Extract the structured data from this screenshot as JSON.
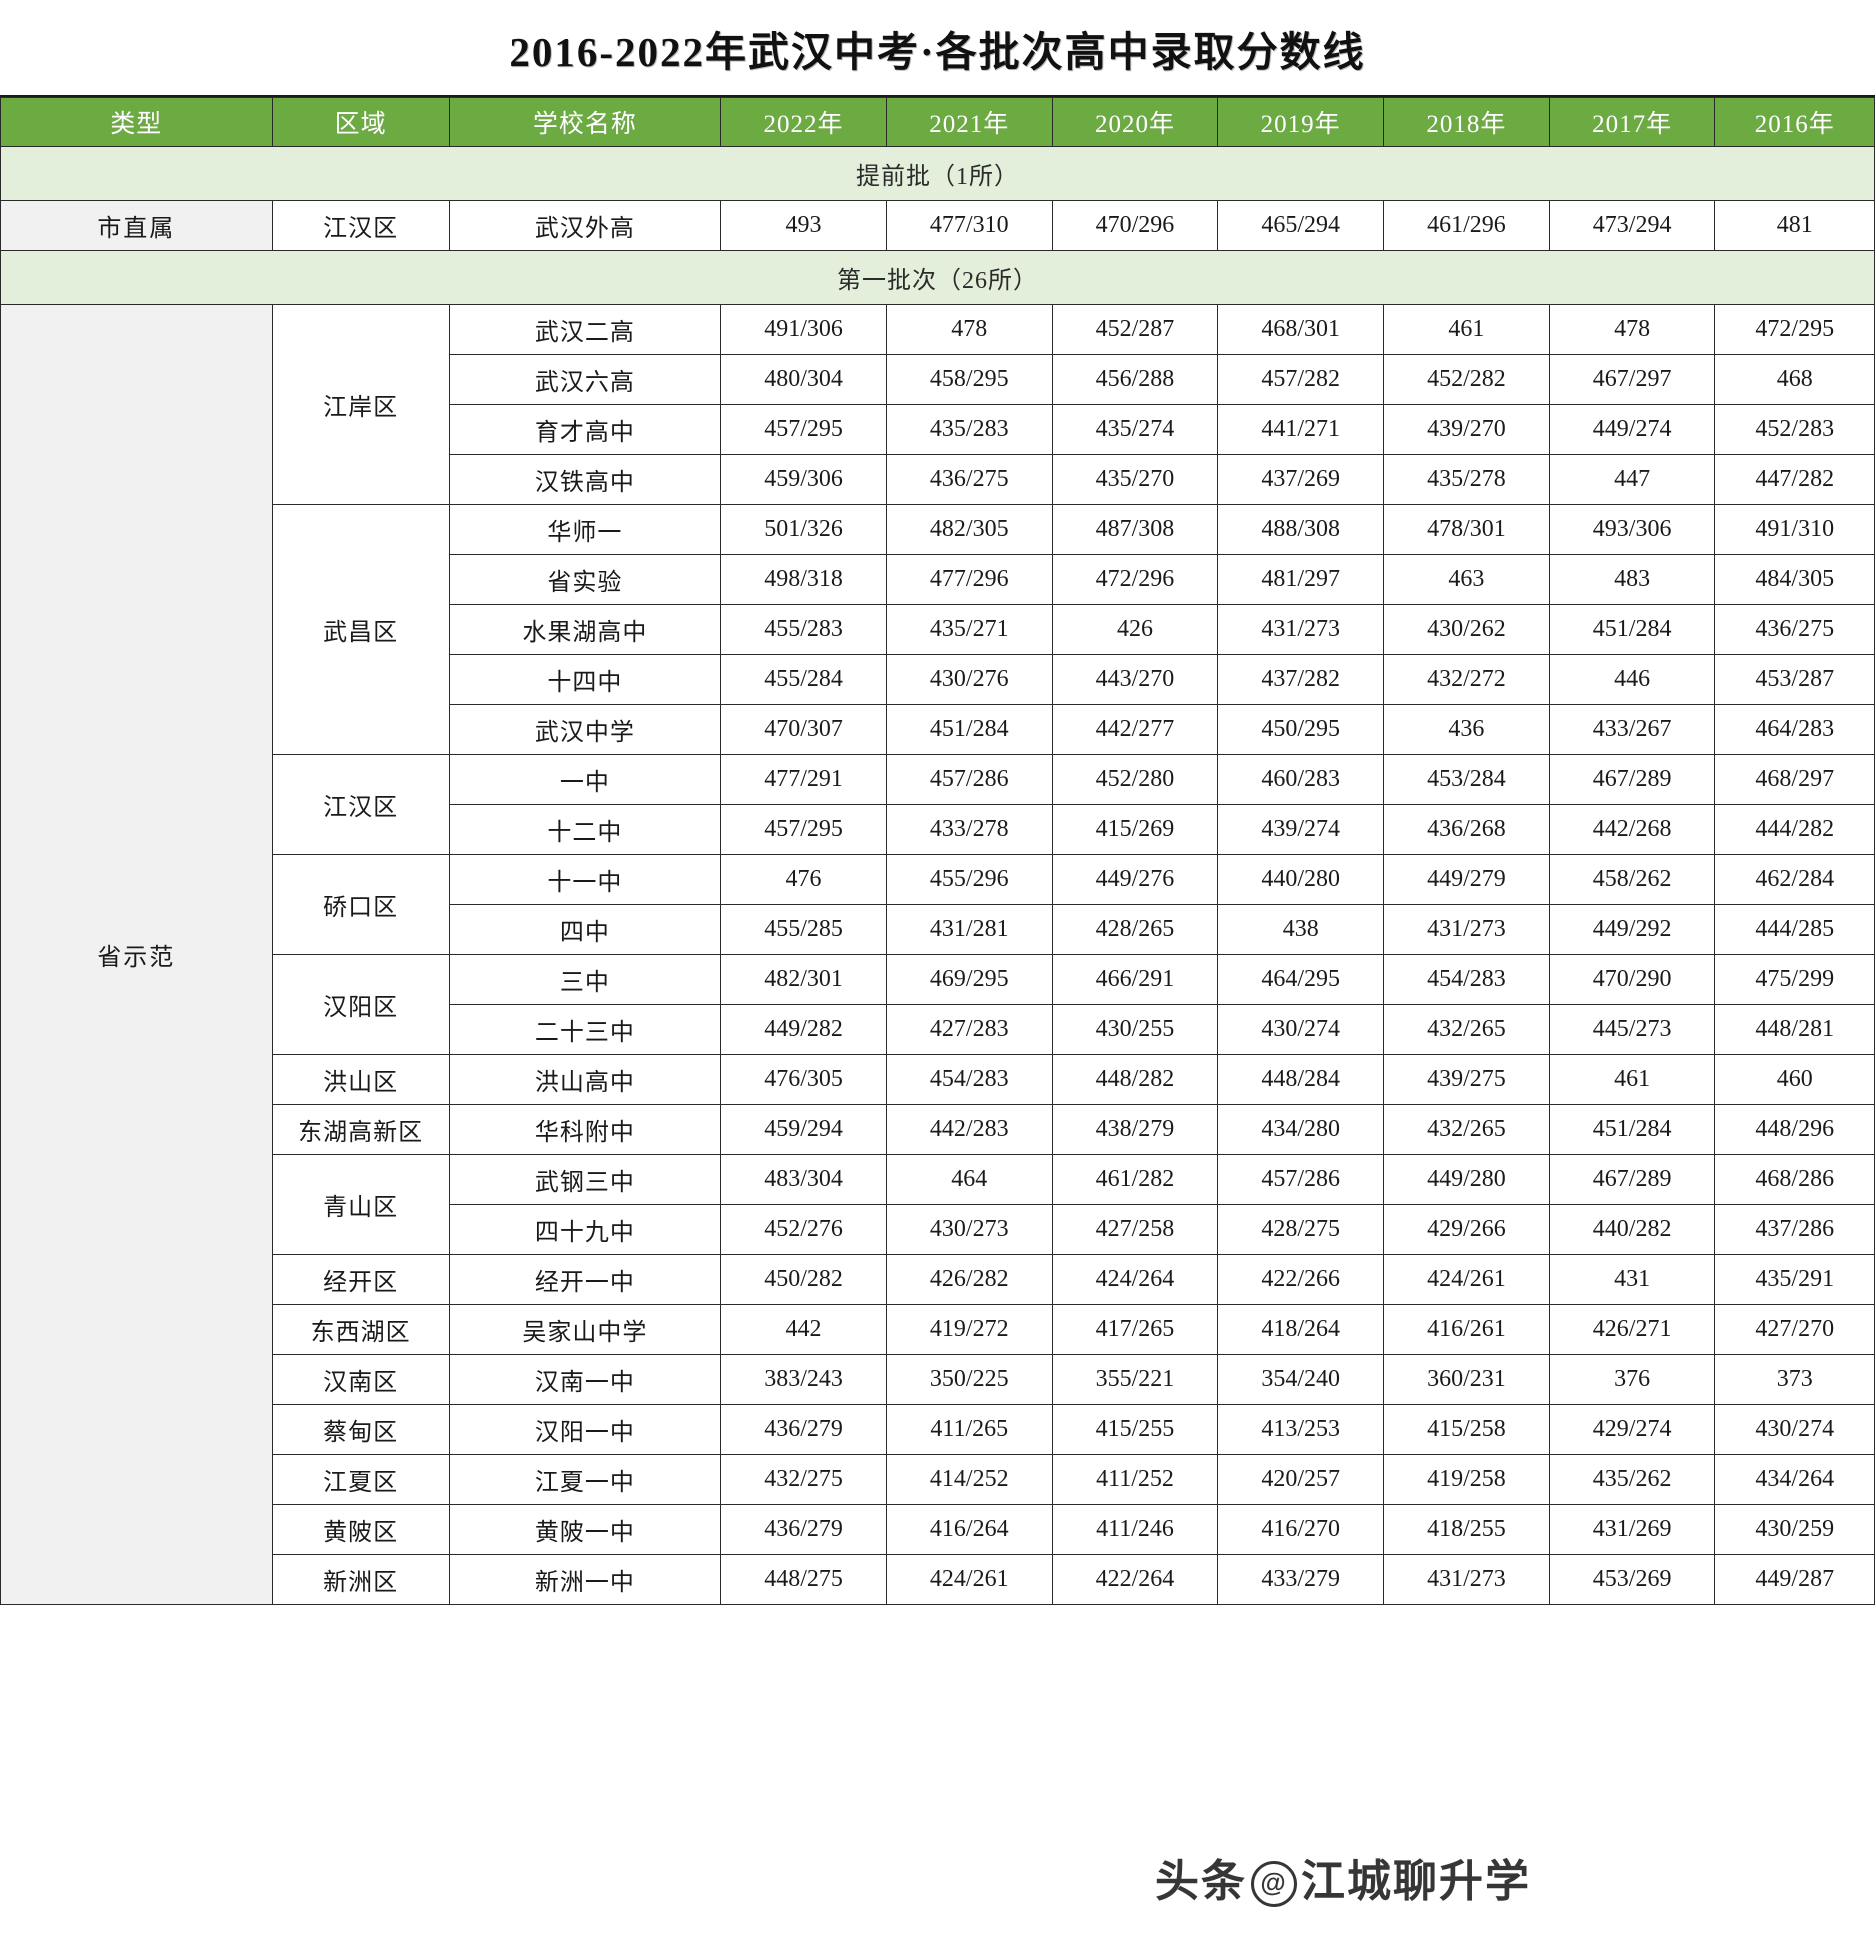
{
  "title": "2016-2022年武汉中考·各批次高中录取分数线",
  "colors": {
    "header_green": "#6cab42",
    "section_green": "#e3eedb",
    "type_gray": "#f1f1f1",
    "border": "#2a2a2a"
  },
  "columns": [
    "类型",
    "区域",
    "学校名称",
    "2022年",
    "2021年",
    "2020年",
    "2019年",
    "2018年",
    "2017年",
    "2016年"
  ],
  "watermark": {
    "brand": "头条",
    "at": "@",
    "account": "江城聊升学"
  },
  "sections": [
    {
      "banner": "提前批（1所）",
      "groups": [
        {
          "type": "市直属",
          "regions": [
            {
              "region": "江汉区",
              "rows": [
                {
                  "school": "武汉外高",
                  "scores": [
                    "493",
                    "477/310",
                    "470/296",
                    "465/294",
                    "461/296",
                    "473/294",
                    "481"
                  ]
                }
              ]
            }
          ]
        }
      ]
    },
    {
      "banner": "第一批次（26所）",
      "groups": [
        {
          "type": "省示范",
          "regions": [
            {
              "region": "江岸区",
              "rows": [
                {
                  "school": "武汉二高",
                  "scores": [
                    "491/306",
                    "478",
                    "452/287",
                    "468/301",
                    "461",
                    "478",
                    "472/295"
                  ]
                },
                {
                  "school": "武汉六高",
                  "scores": [
                    "480/304",
                    "458/295",
                    "456/288",
                    "457/282",
                    "452/282",
                    "467/297",
                    "468"
                  ]
                },
                {
                  "school": "育才高中",
                  "scores": [
                    "457/295",
                    "435/283",
                    "435/274",
                    "441/271",
                    "439/270",
                    "449/274",
                    "452/283"
                  ]
                },
                {
                  "school": "汉铁高中",
                  "scores": [
                    "459/306",
                    "436/275",
                    "435/270",
                    "437/269",
                    "435/278",
                    "447",
                    "447/282"
                  ]
                }
              ]
            },
            {
              "region": "武昌区",
              "rows": [
                {
                  "school": "华师一",
                  "scores": [
                    "501/326",
                    "482/305",
                    "487/308",
                    "488/308",
                    "478/301",
                    "493/306",
                    "491/310"
                  ]
                },
                {
                  "school": "省实验",
                  "scores": [
                    "498/318",
                    "477/296",
                    "472/296",
                    "481/297",
                    "463",
                    "483",
                    "484/305"
                  ]
                },
                {
                  "school": "水果湖高中",
                  "scores": [
                    "455/283",
                    "435/271",
                    "426",
                    "431/273",
                    "430/262",
                    "451/284",
                    "436/275"
                  ]
                },
                {
                  "school": "十四中",
                  "scores": [
                    "455/284",
                    "430/276",
                    "443/270",
                    "437/282",
                    "432/272",
                    "446",
                    "453/287"
                  ]
                },
                {
                  "school": "武汉中学",
                  "scores": [
                    "470/307",
                    "451/284",
                    "442/277",
                    "450/295",
                    "436",
                    "433/267",
                    "464/283"
                  ]
                }
              ]
            },
            {
              "region": "江汉区",
              "rows": [
                {
                  "school": "一中",
                  "scores": [
                    "477/291",
                    "457/286",
                    "452/280",
                    "460/283",
                    "453/284",
                    "467/289",
                    "468/297"
                  ]
                },
                {
                  "school": "十二中",
                  "scores": [
                    "457/295",
                    "433/278",
                    "415/269",
                    "439/274",
                    "436/268",
                    "442/268",
                    "444/282"
                  ]
                }
              ]
            },
            {
              "region": "硚口区",
              "rows": [
                {
                  "school": "十一中",
                  "scores": [
                    "476",
                    "455/296",
                    "449/276",
                    "440/280",
                    "449/279",
                    "458/262",
                    "462/284"
                  ]
                },
                {
                  "school": "四中",
                  "scores": [
                    "455/285",
                    "431/281",
                    "428/265",
                    "438",
                    "431/273",
                    "449/292",
                    "444/285"
                  ]
                }
              ]
            },
            {
              "region": "汉阳区",
              "rows": [
                {
                  "school": "三中",
                  "scores": [
                    "482/301",
                    "469/295",
                    "466/291",
                    "464/295",
                    "454/283",
                    "470/290",
                    "475/299"
                  ]
                },
                {
                  "school": "二十三中",
                  "scores": [
                    "449/282",
                    "427/283",
                    "430/255",
                    "430/274",
                    "432/265",
                    "445/273",
                    "448/281"
                  ]
                }
              ]
            },
            {
              "region": "洪山区",
              "rows": [
                {
                  "school": "洪山高中",
                  "scores": [
                    "476/305",
                    "454/283",
                    "448/282",
                    "448/284",
                    "439/275",
                    "461",
                    "460"
                  ]
                }
              ]
            },
            {
              "region": "东湖高新区",
              "rows": [
                {
                  "school": "华科附中",
                  "scores": [
                    "459/294",
                    "442/283",
                    "438/279",
                    "434/280",
                    "432/265",
                    "451/284",
                    "448/296"
                  ]
                }
              ]
            },
            {
              "region": "青山区",
              "rows": [
                {
                  "school": "武钢三中",
                  "scores": [
                    "483/304",
                    "464",
                    "461/282",
                    "457/286",
                    "449/280",
                    "467/289",
                    "468/286"
                  ]
                },
                {
                  "school": "四十九中",
                  "scores": [
                    "452/276",
                    "430/273",
                    "427/258",
                    "428/275",
                    "429/266",
                    "440/282",
                    "437/286"
                  ]
                }
              ]
            },
            {
              "region": "经开区",
              "rows": [
                {
                  "school": "经开一中",
                  "scores": [
                    "450/282",
                    "426/282",
                    "424/264",
                    "422/266",
                    "424/261",
                    "431",
                    "435/291"
                  ]
                }
              ]
            },
            {
              "region": "东西湖区",
              "rows": [
                {
                  "school": "吴家山中学",
                  "scores": [
                    "442",
                    "419/272",
                    "417/265",
                    "418/264",
                    "416/261",
                    "426/271",
                    "427/270"
                  ]
                }
              ]
            },
            {
              "region": "汉南区",
              "rows": [
                {
                  "school": "汉南一中",
                  "scores": [
                    "383/243",
                    "350/225",
                    "355/221",
                    "354/240",
                    "360/231",
                    "376",
                    "373"
                  ]
                }
              ]
            },
            {
              "region": "蔡甸区",
              "rows": [
                {
                  "school": "汉阳一中",
                  "scores": [
                    "436/279",
                    "411/265",
                    "415/255",
                    "413/253",
                    "415/258",
                    "429/274",
                    "430/274"
                  ]
                }
              ]
            },
            {
              "region": "江夏区",
              "rows": [
                {
                  "school": "江夏一中",
                  "scores": [
                    "432/275",
                    "414/252",
                    "411/252",
                    "420/257",
                    "419/258",
                    "435/262",
                    "434/264"
                  ]
                }
              ]
            },
            {
              "region": "黄陂区",
              "rows": [
                {
                  "school": "黄陂一中",
                  "scores": [
                    "436/279",
                    "416/264",
                    "411/246",
                    "416/270",
                    "418/255",
                    "431/269",
                    "430/259"
                  ]
                }
              ]
            },
            {
              "region": "新洲区",
              "rows": [
                {
                  "school": "新洲一中",
                  "scores": [
                    "448/275",
                    "424/261",
                    "422/264",
                    "433/279",
                    "431/273",
                    "453/269",
                    "449/287"
                  ]
                }
              ]
            }
          ]
        }
      ]
    }
  ]
}
